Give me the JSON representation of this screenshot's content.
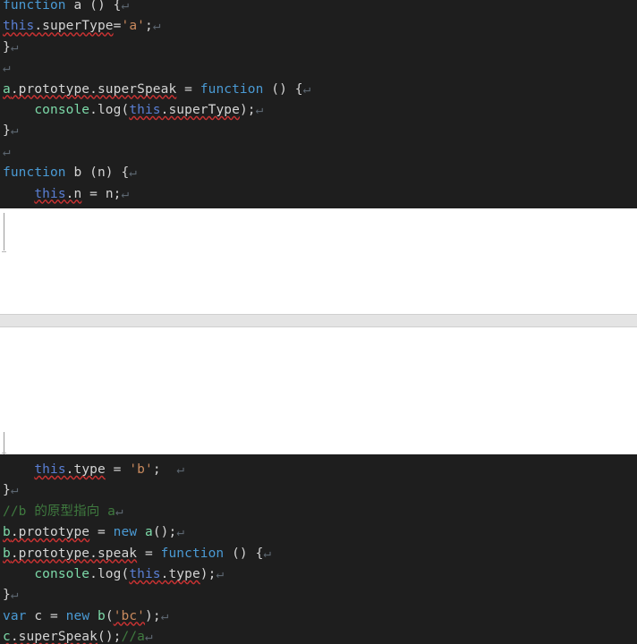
{
  "editor": {
    "theme_background": "#1e1e1e",
    "default_text_color": "#d4d4d4",
    "language": "javascript",
    "spellcheck_underline_color": "#c83232",
    "page_background": "#ffffff",
    "separator_color": "#e4e4e4"
  },
  "colors": {
    "keyword": "#4a9ad4",
    "this_keyword": "#5a7fd4",
    "object": "#7cd9a8",
    "property": "#d4d4d4",
    "string": "#c98a5e",
    "comment": "#3f7a3f",
    "pilcrow": "#5c6670"
  },
  "symbols": {
    "paragraph_mark": "↵"
  },
  "top_block": {
    "lines": [
      {
        "id": "line-1",
        "text": "function a () {",
        "tokens": [
          {
            "t": "function",
            "c": "kw"
          },
          {
            "t": " a ",
            "c": "ident"
          },
          {
            "t": "() {",
            "c": "punc"
          }
        ],
        "mark": true
      },
      {
        "id": "line-2",
        "text": "this.superType='a';",
        "tokens": [
          {
            "t": "this",
            "c": "this",
            "sq": true
          },
          {
            "t": ".superType",
            "c": "prop",
            "sq": true
          },
          {
            "t": "=",
            "c": "punc"
          },
          {
            "t": "'a'",
            "c": "str"
          },
          {
            "t": ";",
            "c": "punc"
          }
        ],
        "mark": true
      },
      {
        "id": "line-3",
        "text": "}",
        "tokens": [
          {
            "t": "}",
            "c": "punc"
          }
        ],
        "mark": true
      },
      {
        "id": "line-4",
        "text": "",
        "tokens": [],
        "mark": true
      },
      {
        "id": "line-5",
        "text": "a.prototype.superSpeak = function () {",
        "tokens": [
          {
            "t": "a",
            "c": "obj",
            "sq": true
          },
          {
            "t": ".prototype.superSpeak",
            "c": "prop",
            "sq": true
          },
          {
            "t": " = ",
            "c": "punc"
          },
          {
            "t": "function",
            "c": "kw"
          },
          {
            "t": " () {",
            "c": "punc"
          }
        ],
        "mark": true
      },
      {
        "id": "line-6",
        "text": "    console.log(this.superType);",
        "tokens": [
          {
            "t": "    ",
            "c": "punc"
          },
          {
            "t": "console",
            "c": "obj"
          },
          {
            "t": ".log",
            "c": "prop"
          },
          {
            "t": "(",
            "c": "punc"
          },
          {
            "t": "this",
            "c": "this",
            "sq": true
          },
          {
            "t": ".superType",
            "c": "prop",
            "sq": true
          },
          {
            "t": ");",
            "c": "punc"
          }
        ],
        "mark": true
      },
      {
        "id": "line-7",
        "text": "}",
        "tokens": [
          {
            "t": "}",
            "c": "punc"
          }
        ],
        "mark": true
      },
      {
        "id": "line-8",
        "text": "",
        "tokens": [],
        "mark": true
      },
      {
        "id": "line-9",
        "text": "function b (n) {",
        "tokens": [
          {
            "t": "function",
            "c": "kw"
          },
          {
            "t": " b ",
            "c": "ident"
          },
          {
            "t": "(n) {",
            "c": "punc"
          }
        ],
        "mark": true
      },
      {
        "id": "line-10",
        "text": "    this.n = n;",
        "tokens": [
          {
            "t": "    ",
            "c": "punc"
          },
          {
            "t": "this",
            "c": "this",
            "sq": true
          },
          {
            "t": ".n",
            "c": "prop",
            "sq": true
          },
          {
            "t": " = n;",
            "c": "punc"
          }
        ],
        "mark": true
      }
    ]
  },
  "bottom_block": {
    "lines": [
      {
        "id": "line-11",
        "text": "    this.type = 'b';  ",
        "tokens": [
          {
            "t": "    ",
            "c": "punc"
          },
          {
            "t": "this",
            "c": "this",
            "sq": true
          },
          {
            "t": ".type",
            "c": "prop",
            "sq": true
          },
          {
            "t": " = ",
            "c": "punc"
          },
          {
            "t": "'b'",
            "c": "str"
          },
          {
            "t": ";  ",
            "c": "punc"
          }
        ],
        "mark": true
      },
      {
        "id": "line-12",
        "text": "}",
        "tokens": [
          {
            "t": "}",
            "c": "punc"
          }
        ],
        "mark": true
      },
      {
        "id": "line-13",
        "text": "//b 的原型指向 a",
        "tokens": [
          {
            "t": "//b 的原型指向 a",
            "c": "cmt"
          }
        ],
        "mark": true
      },
      {
        "id": "line-14",
        "text": "b.prototype = new a();",
        "tokens": [
          {
            "t": "b",
            "c": "obj",
            "sq": true
          },
          {
            "t": ".prototype",
            "c": "prop",
            "sq": true
          },
          {
            "t": " = ",
            "c": "punc"
          },
          {
            "t": "new",
            "c": "kw"
          },
          {
            "t": " ",
            "c": "punc"
          },
          {
            "t": "a",
            "c": "obj"
          },
          {
            "t": "();",
            "c": "punc"
          }
        ],
        "mark": true
      },
      {
        "id": "line-15",
        "text": "b.prototype.speak = function () {",
        "tokens": [
          {
            "t": "b",
            "c": "obj",
            "sq": true
          },
          {
            "t": ".prototype.speak",
            "c": "prop",
            "sq": true
          },
          {
            "t": " = ",
            "c": "punc"
          },
          {
            "t": "function",
            "c": "kw"
          },
          {
            "t": " () {",
            "c": "punc"
          }
        ],
        "mark": true
      },
      {
        "id": "line-16",
        "text": "    console.log(this.type);",
        "tokens": [
          {
            "t": "    ",
            "c": "punc"
          },
          {
            "t": "console",
            "c": "obj"
          },
          {
            "t": ".log",
            "c": "prop"
          },
          {
            "t": "(",
            "c": "punc"
          },
          {
            "t": "this",
            "c": "this",
            "sq": true
          },
          {
            "t": ".type",
            "c": "prop",
            "sq": true
          },
          {
            "t": ");",
            "c": "punc"
          }
        ],
        "mark": true
      },
      {
        "id": "line-17",
        "text": "}",
        "tokens": [
          {
            "t": "}",
            "c": "punc"
          }
        ],
        "mark": true
      },
      {
        "id": "line-18",
        "text": "var c = new b('bc');",
        "tokens": [
          {
            "t": "var",
            "c": "kw"
          },
          {
            "t": " c = ",
            "c": "punc"
          },
          {
            "t": "new",
            "c": "kw"
          },
          {
            "t": " ",
            "c": "punc"
          },
          {
            "t": "b",
            "c": "obj"
          },
          {
            "t": "(",
            "c": "punc"
          },
          {
            "t": "'bc'",
            "c": "str",
            "sq": true
          },
          {
            "t": ");",
            "c": "punc"
          }
        ],
        "mark": true
      },
      {
        "id": "line-19",
        "text": "c.superSpeak();//a",
        "tokens": [
          {
            "t": "c",
            "c": "obj",
            "sq": true
          },
          {
            "t": ".superSpeak",
            "c": "prop",
            "sq": true
          },
          {
            "t": "();",
            "c": "punc"
          },
          {
            "t": "//a",
            "c": "cmt"
          }
        ],
        "mark": true
      }
    ]
  }
}
